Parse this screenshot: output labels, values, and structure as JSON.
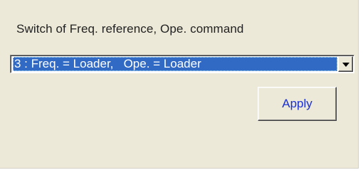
{
  "group": {
    "label": "Switch of Freq. reference, Ope. command"
  },
  "select": {
    "selected_value": "3 : Freq. = Loader,   Ope. = Loader"
  },
  "apply_button": {
    "label": "Apply"
  },
  "colors": {
    "panel_background": "#ece9d8",
    "selection_highlight": "#316ac5",
    "apply_text": "#1a2ed6"
  },
  "icons": {
    "dropdown": "chevron-down-icon"
  }
}
